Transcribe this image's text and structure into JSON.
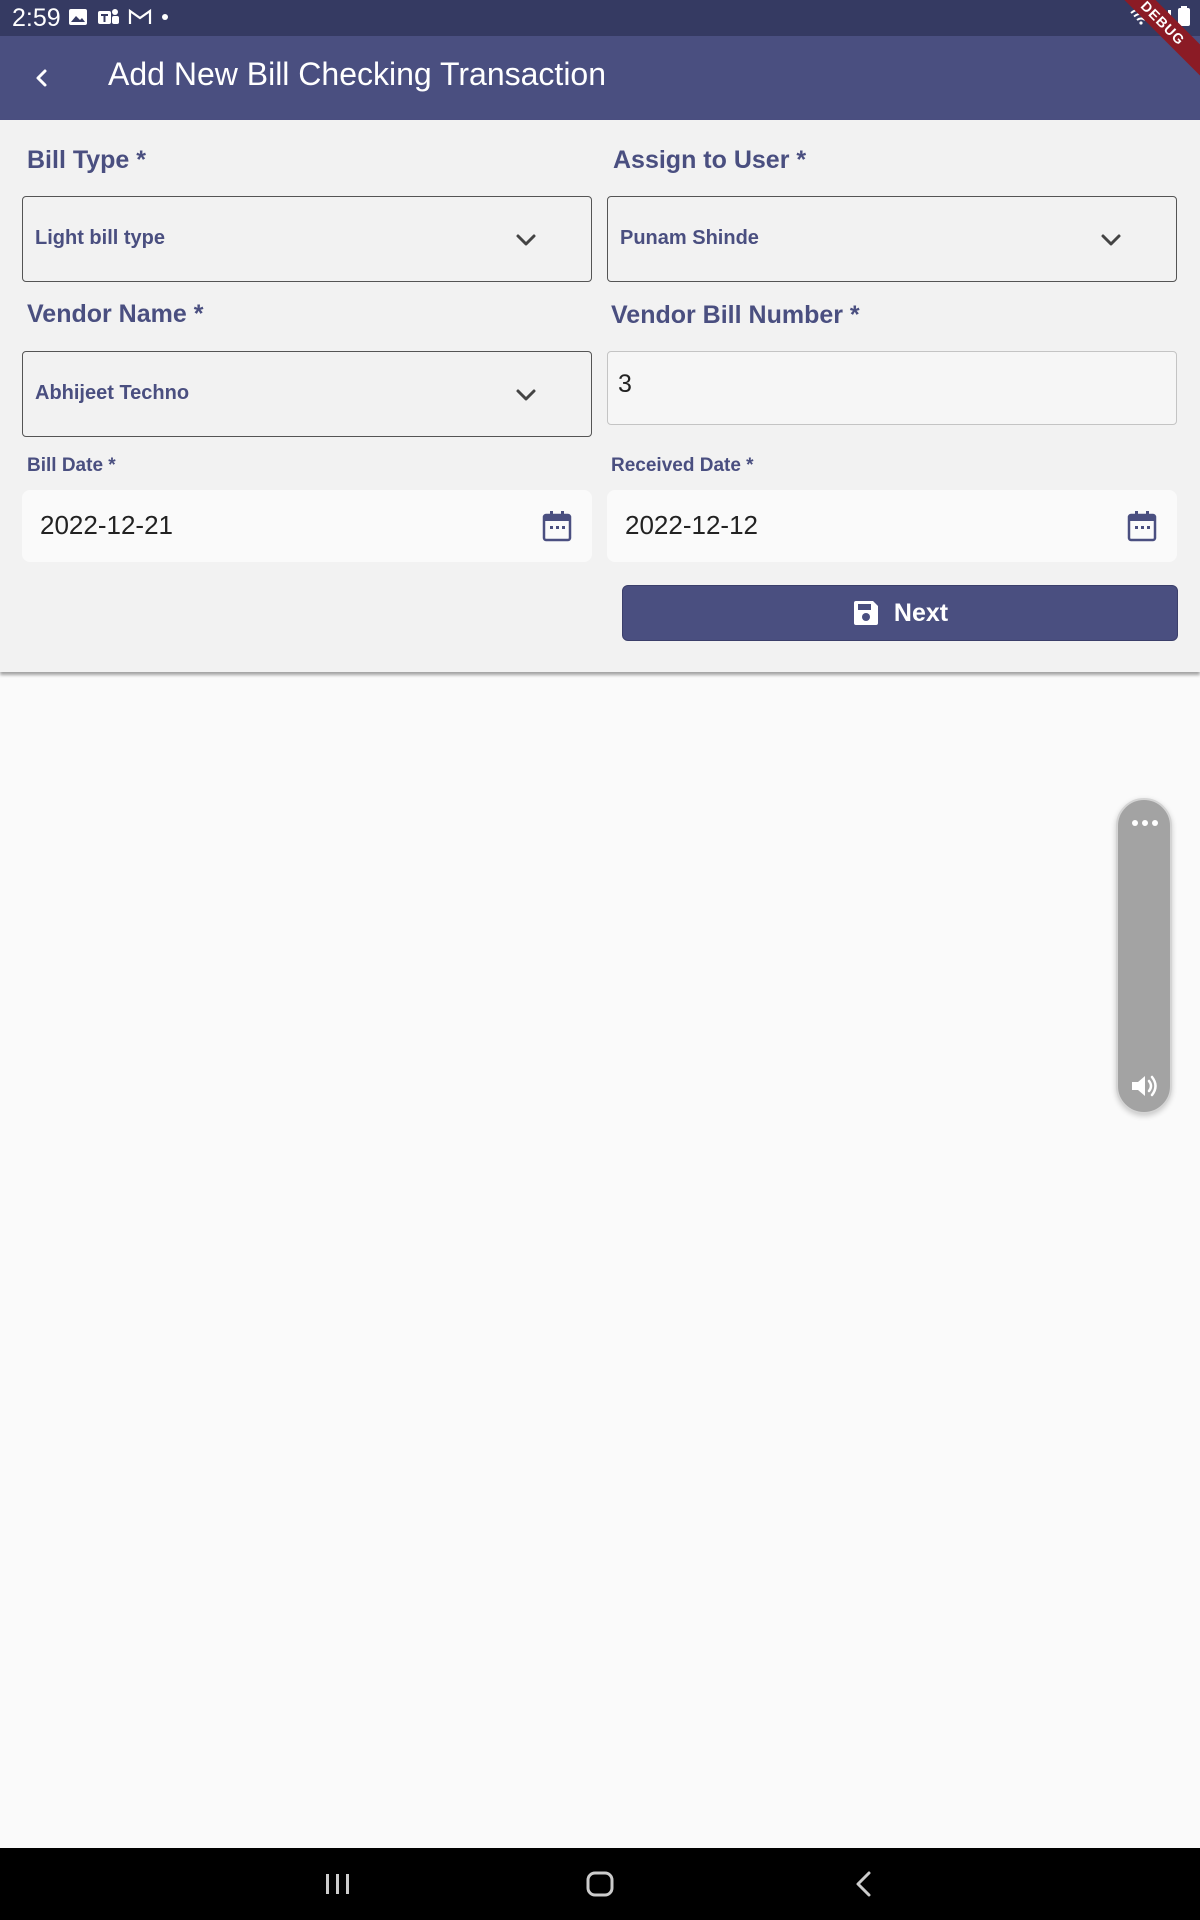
{
  "status_bar": {
    "time": "2:59",
    "icons": [
      "gallery-icon",
      "teams-icon",
      "gmail-icon",
      "dot-icon",
      "wifi-icon",
      "signal-icon",
      "battery-icon"
    ]
  },
  "app_bar": {
    "title": "Add New Bill Checking Transaction",
    "back_icon": "back-arrow-icon",
    "debug_banner": "DEBUG"
  },
  "form": {
    "bill_type": {
      "label": "Bill Type *",
      "value": "Light bill type"
    },
    "assign_to_user": {
      "label": "Assign to User *",
      "value": "Punam Shinde"
    },
    "vendor_name": {
      "label": "Vendor Name *",
      "value": "Abhijeet Techno"
    },
    "vendor_bill_number": {
      "label": "Vendor Bill Number *",
      "value": "3"
    },
    "bill_date": {
      "label": "Bill Date *",
      "value": "2022-12-21"
    },
    "received_date": {
      "label": "Received Date *",
      "value": "2022-12-12"
    },
    "next_button": {
      "label": "Next",
      "icon": "save-icon"
    }
  },
  "floating_panel": {
    "icons": [
      "more-icon",
      "volume-icon"
    ]
  },
  "nav_bar": {
    "icons": [
      "recents-icon",
      "home-icon",
      "back-icon"
    ]
  },
  "colors": {
    "primary": "#4a4f80",
    "status_bar": "#353a62",
    "form_background": "#f2f2f2",
    "page_background": "#fafafa",
    "debug_ribbon": "#8b1b25"
  }
}
